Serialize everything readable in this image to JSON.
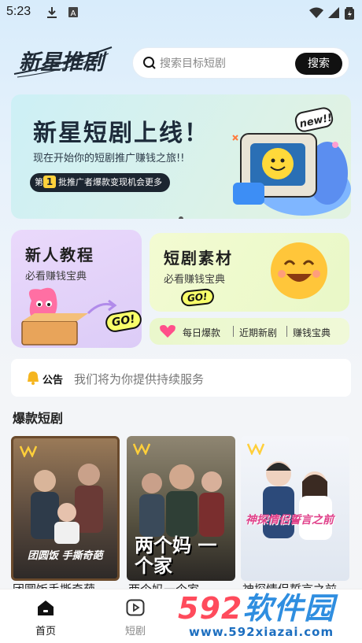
{
  "status_bar": {
    "time": "5:23"
  },
  "header": {
    "logo_text": "新星推剧",
    "search_placeholder": "搜索目标短剧",
    "search_button": "搜索"
  },
  "banner": {
    "title": "新星短剧上线！",
    "subtitle": "现在开始你的短剧推广赚钱之旅!!",
    "pill_number": "1",
    "pill_prefix": "第",
    "pill_text": "批推广者爆款变现机会更多",
    "badge": "new!!"
  },
  "cards": {
    "tutorial": {
      "title": "新人教程",
      "subtitle": "必看赚钱宝典",
      "go": "GO!"
    },
    "material": {
      "title": "短剧素材",
      "subtitle": "必看赚钱宝典",
      "go": "GO!"
    }
  },
  "quick_links": [
    "每日爆款",
    "近期新剧",
    "赚钱宝典"
  ],
  "notice": {
    "label": "公告",
    "text": "我们将为你提供持续服务"
  },
  "section": {
    "title": "爆款短剧"
  },
  "dramas": [
    {
      "poster_text": "团圆饭 手撕奇葩",
      "title": "团圆饭手撕奇葩",
      "colors": [
        "#8a6b4e",
        "#3d3a3a"
      ]
    },
    {
      "poster_text": "两个妈 一个家",
      "title": "两个妈一个家",
      "colors": [
        "#7b7162",
        "#2e2a26"
      ]
    },
    {
      "poster_text": "神探情侣誓言之前",
      "title": "神探情侣誓言之前",
      "colors": [
        "#e9eef6",
        "#cdd8e8"
      ]
    }
  ],
  "bottom_nav": [
    {
      "label": "首页",
      "active": true
    },
    {
      "label": "短剧",
      "active": false
    }
  ],
  "watermark": {
    "main_num": "592",
    "main_cn": "软件园",
    "url": "www.592xiazai.com"
  },
  "colors": {
    "accent": "#111111",
    "active_nav": "#111111",
    "inactive_nav": "#888888"
  }
}
